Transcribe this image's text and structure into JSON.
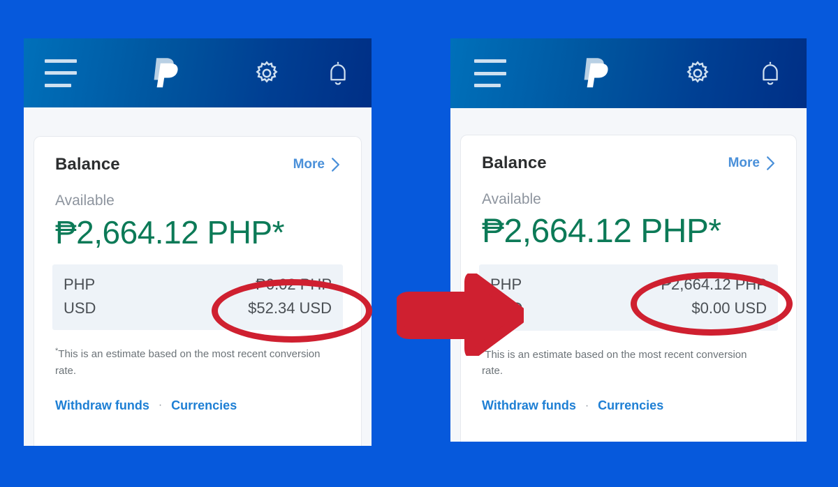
{
  "page": {
    "background_color": "#0659dc",
    "accent_annotation_color": "#cf2030",
    "brand_blue": "#0070ba",
    "brand_navy": "#003087",
    "balance_green": "#0c7a57",
    "link_blue": "#1e7fd4"
  },
  "appbar": {
    "menu_icon": "hamburger-menu-icon",
    "logo_icon": "paypal-logo-icon",
    "settings_icon": "gear-icon",
    "notifications_icon": "bell-icon"
  },
  "panels": [
    {
      "id": "before",
      "card": {
        "title": "Balance",
        "more_label": "More",
        "more_chevron": "chevron-right-icon",
        "available_label": "Available",
        "available_amount": "₱2,664.12 PHP*",
        "currencies": [
          {
            "code": "PHP",
            "value": "₱0.02 PHP"
          },
          {
            "code": "USD",
            "value": "$52.34 USD"
          }
        ],
        "footnote_star": "*",
        "footnote": "This is an estimate based on the most recent conversion rate.",
        "links": {
          "withdraw": "Withdraw funds",
          "separator": "·",
          "currencies": "Currencies"
        }
      }
    },
    {
      "id": "after",
      "card": {
        "title": "Balance",
        "more_label": "More",
        "more_chevron": "chevron-right-icon",
        "available_label": "Available",
        "available_amount": "₱2,664.12 PHP*",
        "currencies": [
          {
            "code": "PHP",
            "value": "₱2,664.12 PHP"
          },
          {
            "code": "USD",
            "value": "$0.00 USD"
          }
        ],
        "footnote_star": "*",
        "footnote": "This is an estimate based on the most recent conversion rate.",
        "links": {
          "withdraw": "Withdraw funds",
          "separator": "·",
          "currencies": "Currencies"
        }
      }
    }
  ],
  "annotations": {
    "arrow": "red-right-arrow",
    "highlight_before": "red-ellipse-around-currency-values-before",
    "highlight_after": "red-ellipse-around-currency-values-after"
  }
}
